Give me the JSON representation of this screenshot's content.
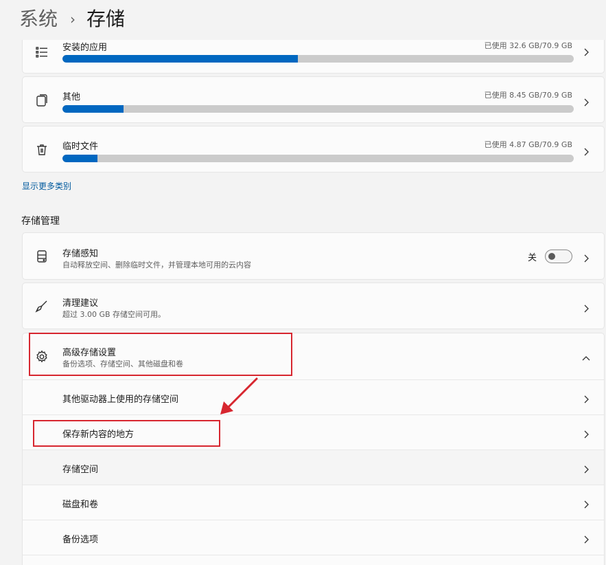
{
  "breadcrumb": {
    "parent": "系统",
    "separator": "›",
    "current": "存储"
  },
  "categories": [
    {
      "name": "安装的应用",
      "usage": "已使用 32.6 GB/70.9 GB",
      "fraction": 0.46,
      "icon": "app-list-icon"
    },
    {
      "name": "其他",
      "usage": "已使用 8.45 GB/70.9 GB",
      "fraction": 0.12,
      "icon": "other-files-icon"
    },
    {
      "name": "临时文件",
      "usage": "已使用 4.87 GB/70.9 GB",
      "fraction": 0.069,
      "icon": "trash-icon"
    }
  ],
  "show_more": "显示更多类别",
  "management": {
    "title": "存储管理",
    "storage_sense": {
      "title": "存储感知",
      "subtitle": "自动释放空间、删除临时文件，并管理本地可用的云内容",
      "toggle_label": "关",
      "toggle_on": false
    },
    "cleanup": {
      "title": "清理建议",
      "subtitle": "超过 3.00 GB 存储空间可用。"
    },
    "advanced": {
      "title": "高级存储设置",
      "subtitle": "备份选项、存储空间、其他磁盘和卷",
      "items": [
        "其他驱动器上使用的存储空间",
        "保存新内容的地方",
        "存储空间",
        "磁盘和卷",
        "备份选项"
      ]
    }
  },
  "colors": {
    "accent": "#0067c0",
    "highlight": "#d7262f",
    "track": "#cbcbcb"
  }
}
